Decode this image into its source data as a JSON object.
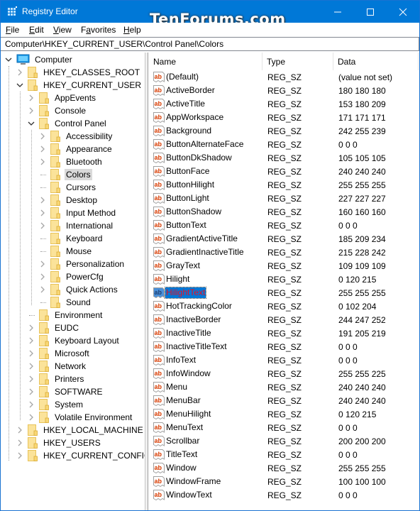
{
  "window": {
    "title": "Registry Editor",
    "watermark": "TenForums.com",
    "controls": {
      "minimize": "minimize",
      "maximize": "maximize",
      "close": "close"
    }
  },
  "menu": [
    {
      "label": "File",
      "accel": "F",
      "rest": "ile"
    },
    {
      "label": "Edit",
      "accel": "E",
      "rest": "dit"
    },
    {
      "label": "View",
      "accel": "V",
      "rest": "iew"
    },
    {
      "label": "Favorites",
      "accel": "a",
      "pre": "F",
      "rest": "vorites"
    },
    {
      "label": "Help",
      "accel": "H",
      "rest": "elp"
    }
  ],
  "address": {
    "value": "Computer\\HKEY_CURRENT_USER\\Control Panel\\Colors"
  },
  "tree": {
    "root": {
      "label": "Computer",
      "icon": "computer-icon",
      "expanded": true
    },
    "nodes": [
      {
        "label": "HKEY_CLASSES_ROOT",
        "level": 1,
        "expander": "collapsed"
      },
      {
        "label": "HKEY_CURRENT_USER",
        "level": 1,
        "expander": "expanded"
      },
      {
        "label": "AppEvents",
        "level": 2,
        "expander": "collapsed"
      },
      {
        "label": "Console",
        "level": 2,
        "expander": "collapsed"
      },
      {
        "label": "Control Panel",
        "level": 2,
        "expander": "expanded"
      },
      {
        "label": "Accessibility",
        "level": 3,
        "expander": "collapsed"
      },
      {
        "label": "Appearance",
        "level": 3,
        "expander": "collapsed"
      },
      {
        "label": "Bluetooth",
        "level": 3,
        "expander": "collapsed"
      },
      {
        "label": "Colors",
        "level": 3,
        "expander": "none",
        "selected": true
      },
      {
        "label": "Cursors",
        "level": 3,
        "expander": "none"
      },
      {
        "label": "Desktop",
        "level": 3,
        "expander": "collapsed"
      },
      {
        "label": "Input Method",
        "level": 3,
        "expander": "collapsed"
      },
      {
        "label": "International",
        "level": 3,
        "expander": "collapsed"
      },
      {
        "label": "Keyboard",
        "level": 3,
        "expander": "none"
      },
      {
        "label": "Mouse",
        "level": 3,
        "expander": "none"
      },
      {
        "label": "Personalization",
        "level": 3,
        "expander": "collapsed"
      },
      {
        "label": "PowerCfg",
        "level": 3,
        "expander": "collapsed"
      },
      {
        "label": "Quick Actions",
        "level": 3,
        "expander": "collapsed"
      },
      {
        "label": "Sound",
        "level": 3,
        "expander": "none"
      },
      {
        "label": "Environment",
        "level": 2,
        "expander": "none"
      },
      {
        "label": "EUDC",
        "level": 2,
        "expander": "collapsed"
      },
      {
        "label": "Keyboard Layout",
        "level": 2,
        "expander": "collapsed"
      },
      {
        "label": "Microsoft",
        "level": 2,
        "expander": "collapsed"
      },
      {
        "label": "Network",
        "level": 2,
        "expander": "collapsed"
      },
      {
        "label": "Printers",
        "level": 2,
        "expander": "collapsed"
      },
      {
        "label": "SOFTWARE",
        "level": 2,
        "expander": "collapsed"
      },
      {
        "label": "System",
        "level": 2,
        "expander": "collapsed"
      },
      {
        "label": "Volatile Environment",
        "level": 2,
        "expander": "collapsed"
      },
      {
        "label": "HKEY_LOCAL_MACHINE",
        "level": 1,
        "expander": "collapsed"
      },
      {
        "label": "HKEY_USERS",
        "level": 1,
        "expander": "collapsed"
      },
      {
        "label": "HKEY_CURRENT_CONFIG",
        "level": 1,
        "expander": "collapsed"
      }
    ]
  },
  "list": {
    "columns": {
      "name": "Name",
      "type": "Type",
      "data": "Data"
    },
    "rows": [
      {
        "name": "(Default)",
        "type": "REG_SZ",
        "data": "(value not set)"
      },
      {
        "name": "ActiveBorder",
        "type": "REG_SZ",
        "data": "180 180 180"
      },
      {
        "name": "ActiveTitle",
        "type": "REG_SZ",
        "data": "153 180 209"
      },
      {
        "name": "AppWorkspace",
        "type": "REG_SZ",
        "data": "171 171 171"
      },
      {
        "name": "Background",
        "type": "REG_SZ",
        "data": "242 255 239"
      },
      {
        "name": "ButtonAlternateFace",
        "type": "REG_SZ",
        "data": "0 0 0"
      },
      {
        "name": "ButtonDkShadow",
        "type": "REG_SZ",
        "data": "105 105 105"
      },
      {
        "name": "ButtonFace",
        "type": "REG_SZ",
        "data": "240 240 240"
      },
      {
        "name": "ButtonHilight",
        "type": "REG_SZ",
        "data": "255 255 255"
      },
      {
        "name": "ButtonLight",
        "type": "REG_SZ",
        "data": "227 227 227"
      },
      {
        "name": "ButtonShadow",
        "type": "REG_SZ",
        "data": "160 160 160"
      },
      {
        "name": "ButtonText",
        "type": "REG_SZ",
        "data": "0 0 0"
      },
      {
        "name": "GradientActiveTitle",
        "type": "REG_SZ",
        "data": "185 209 234"
      },
      {
        "name": "GradientInactiveTitle",
        "type": "REG_SZ",
        "data": "215 228 242"
      },
      {
        "name": "GrayText",
        "type": "REG_SZ",
        "data": "109 109 109"
      },
      {
        "name": "Hilight",
        "type": "REG_SZ",
        "data": "0 120 215"
      },
      {
        "name": "HilightText",
        "type": "REG_SZ",
        "data": "255 255 255",
        "selected": true
      },
      {
        "name": "HotTrackingColor",
        "type": "REG_SZ",
        "data": "0 102 204"
      },
      {
        "name": "InactiveBorder",
        "type": "REG_SZ",
        "data": "244 247 252"
      },
      {
        "name": "InactiveTitle",
        "type": "REG_SZ",
        "data": "191 205 219"
      },
      {
        "name": "InactiveTitleText",
        "type": "REG_SZ",
        "data": "0 0 0"
      },
      {
        "name": "InfoText",
        "type": "REG_SZ",
        "data": "0 0 0"
      },
      {
        "name": "InfoWindow",
        "type": "REG_SZ",
        "data": "255 255 225"
      },
      {
        "name": "Menu",
        "type": "REG_SZ",
        "data": "240 240 240"
      },
      {
        "name": "MenuBar",
        "type": "REG_SZ",
        "data": "240 240 240"
      },
      {
        "name": "MenuHilight",
        "type": "REG_SZ",
        "data": "0 120 215"
      },
      {
        "name": "MenuText",
        "type": "REG_SZ",
        "data": "0 0 0"
      },
      {
        "name": "Scrollbar",
        "type": "REG_SZ",
        "data": "200 200 200"
      },
      {
        "name": "TitleText",
        "type": "REG_SZ",
        "data": "0 0 0"
      },
      {
        "name": "Window",
        "type": "REG_SZ",
        "data": "255 255 255"
      },
      {
        "name": "WindowFrame",
        "type": "REG_SZ",
        "data": "100 100 100"
      },
      {
        "name": "WindowText",
        "type": "REG_SZ",
        "data": "0 0 0"
      }
    ]
  },
  "colors": {
    "titlebar": "#0078d7",
    "selection": "#0078d7",
    "selected_text": "#e81123",
    "tree_selected": "#d9d9d9",
    "folder": "#f8d775",
    "reg_icon": "#d83b01"
  }
}
